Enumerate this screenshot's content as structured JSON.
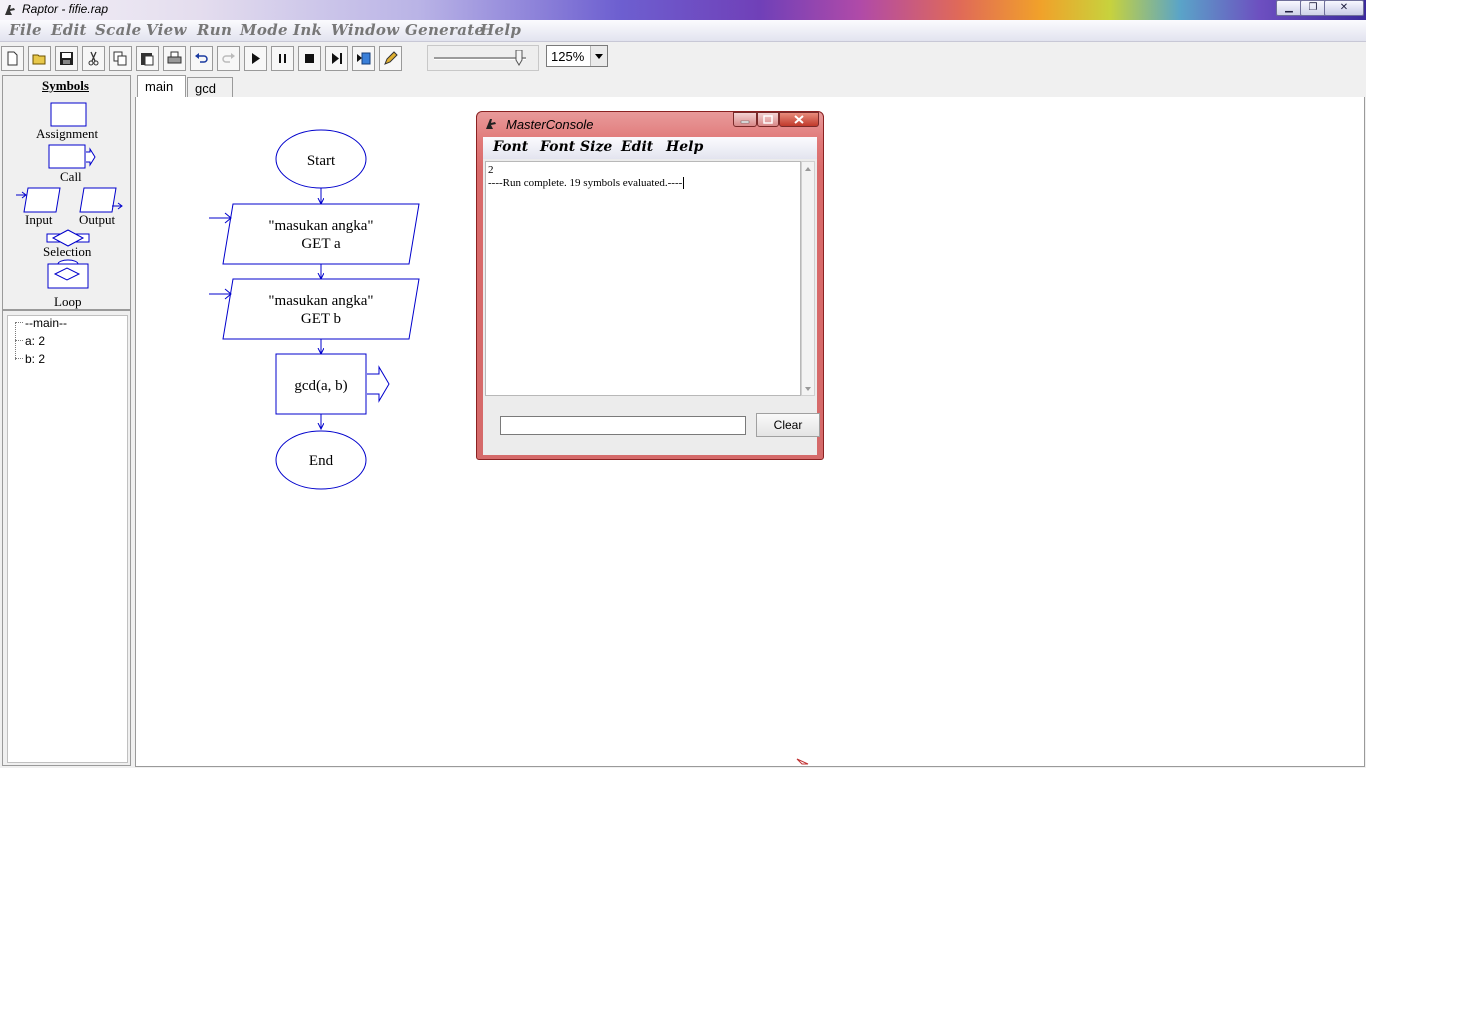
{
  "window": {
    "title": "Raptor - fifie.rap",
    "buttons": {
      "minimize": "▁",
      "maximize": "❐",
      "close": "✕"
    }
  },
  "menu": {
    "items": [
      "File",
      "Edit",
      "Scale",
      "View",
      "Run",
      "Mode",
      "Ink",
      "Window",
      "Generate",
      "Help"
    ]
  },
  "toolbar": {
    "icons": [
      "new-file-icon",
      "open-folder-icon",
      "save-icon",
      "cut-icon",
      "copy-icon",
      "paste-icon",
      "print-icon",
      "undo-icon",
      "redo-icon",
      "play-icon",
      "pause-icon",
      "stop-icon",
      "step-icon",
      "test-server-icon",
      "pen-icon"
    ],
    "zoom": "125%"
  },
  "symbols": {
    "header": "Symbols",
    "items": [
      "Assignment",
      "Call",
      "Input",
      "Output",
      "Selection",
      "Loop"
    ]
  },
  "watch": {
    "root": "--main--",
    "vars": [
      "a: 2",
      "b: 2"
    ]
  },
  "tabs": [
    "main",
    "gcd"
  ],
  "flowchart": {
    "start": "Start",
    "input1_prompt": "\"masukan angka\"",
    "input1_get": "GET a",
    "input2_prompt": "\"masukan angka\"",
    "input2_get": "GET b",
    "call": "gcd(a, b)",
    "end": "End"
  },
  "console": {
    "title": "MasterConsole",
    "menu": [
      "Font",
      "Font Size",
      "Edit",
      "Help"
    ],
    "output": [
      "2",
      "----Run complete.  19 symbols evaluated.----"
    ],
    "input_value": "",
    "clear_label": "Clear"
  },
  "colors": {
    "flowchart_stroke": "#0000cc",
    "console_frame": "#d96a6a"
  }
}
